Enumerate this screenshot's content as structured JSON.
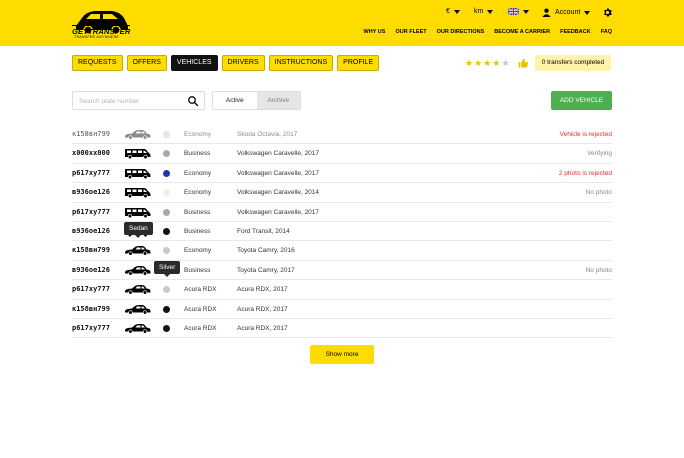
{
  "brand": {
    "name": "GETTRANSFER",
    "tagline": "TRANSFER ANYWHERE"
  },
  "header": {
    "currency": "€",
    "units": "km",
    "account_label": "Account",
    "icons": {
      "language": "uk-flag-icon",
      "account": "user-icon",
      "settings": "gear-icon"
    },
    "nav": [
      "WHY US",
      "OUR FLEET",
      "OUR DIRECTIONS",
      "BECOME A CARRIER",
      "FEEDBACK",
      "FAQ"
    ]
  },
  "tabs": [
    {
      "label": "REQUESTS",
      "active": false
    },
    {
      "label": "OFFERS",
      "active": false
    },
    {
      "label": "VEHICLES",
      "active": true
    },
    {
      "label": "DRIVERS",
      "active": false
    },
    {
      "label": "INSTRUCTIONS",
      "active": false
    },
    {
      "label": "PROFILE",
      "active": false
    }
  ],
  "rating": {
    "stars": 4,
    "max": 5
  },
  "transfers_completed": "0 transfers completed",
  "search": {
    "placeholder": "Search plate number",
    "value": ""
  },
  "filter": {
    "active_label": "Active",
    "archive_label": "Archive",
    "selected": "Active"
  },
  "add_vehicle_label": "ADD VEHICLE",
  "vehicles": [
    {
      "plate": "к158вн799",
      "car": "sedan",
      "color": "#e6e6e6",
      "class": "Economy",
      "model": "Skoda Octavia, 2017",
      "status": "Vehicle is rejected",
      "status_tone": "red",
      "dim": true
    },
    {
      "plate": "х000хх000",
      "car": "van",
      "color": "#a8a8a8",
      "class": "Business",
      "model": "Volkswagen Caravelle, 2017",
      "status": "Verifying",
      "status_tone": "gray",
      "dim": false
    },
    {
      "plate": "р617ху777",
      "car": "van",
      "color": "#2433a8",
      "class": "Economy",
      "model": "Volkswagen Caravelle, 2017",
      "status": "2 photo is rejected",
      "status_tone": "red",
      "dim": false
    },
    {
      "plate": "в936ое126",
      "car": "van",
      "color": "#eeeeee",
      "class": "Economy",
      "model": "Volkswagen Caravelle, 2014",
      "status": "No photo",
      "status_tone": "gray",
      "dim": false
    },
    {
      "plate": "р617ху777",
      "car": "van",
      "color": "#a8a8a8",
      "class": "Business",
      "model": "Volkswagen Caravelle, 2017",
      "status": "",
      "status_tone": "gray",
      "dim": false
    },
    {
      "plate": "в936ое126",
      "car": "van",
      "color": "#111111",
      "class": "Business",
      "model": "Ford Transit, 2014",
      "status": "",
      "status_tone": "gray",
      "dim": false
    },
    {
      "plate": "к158вн799",
      "car": "sedan",
      "color": "#c8c8c8",
      "class": "Economy",
      "model": "Toyota Camry, 2016",
      "status": "",
      "status_tone": "gray",
      "dim": false
    },
    {
      "plate": "в936ое126",
      "car": "sedan",
      "color": "#111111",
      "class": "Business",
      "model": "Toyota Camry, 2017",
      "status": "No photo",
      "status_tone": "gray",
      "dim": false
    },
    {
      "plate": "р617ху777",
      "car": "sedan",
      "color": "#c8c8c8",
      "class": "Acura RDX",
      "model": "Acura RDX, 2017",
      "status": "",
      "status_tone": "gray",
      "dim": false
    },
    {
      "plate": "к158вн799",
      "car": "sedan",
      "color": "#111111",
      "class": "Acura RDX",
      "model": "Acura RDX, 2017",
      "status": "",
      "status_tone": "gray",
      "dim": false
    },
    {
      "plate": "р617ху777",
      "car": "sedan",
      "color": "#111111",
      "class": "Acura RDX",
      "model": "Acura RDX, 2017",
      "status": "",
      "status_tone": "gray",
      "dim": false
    }
  ],
  "tooltips": {
    "car_type": "Sedan",
    "car_color": "Silver"
  },
  "show_more_label": "Show more"
}
